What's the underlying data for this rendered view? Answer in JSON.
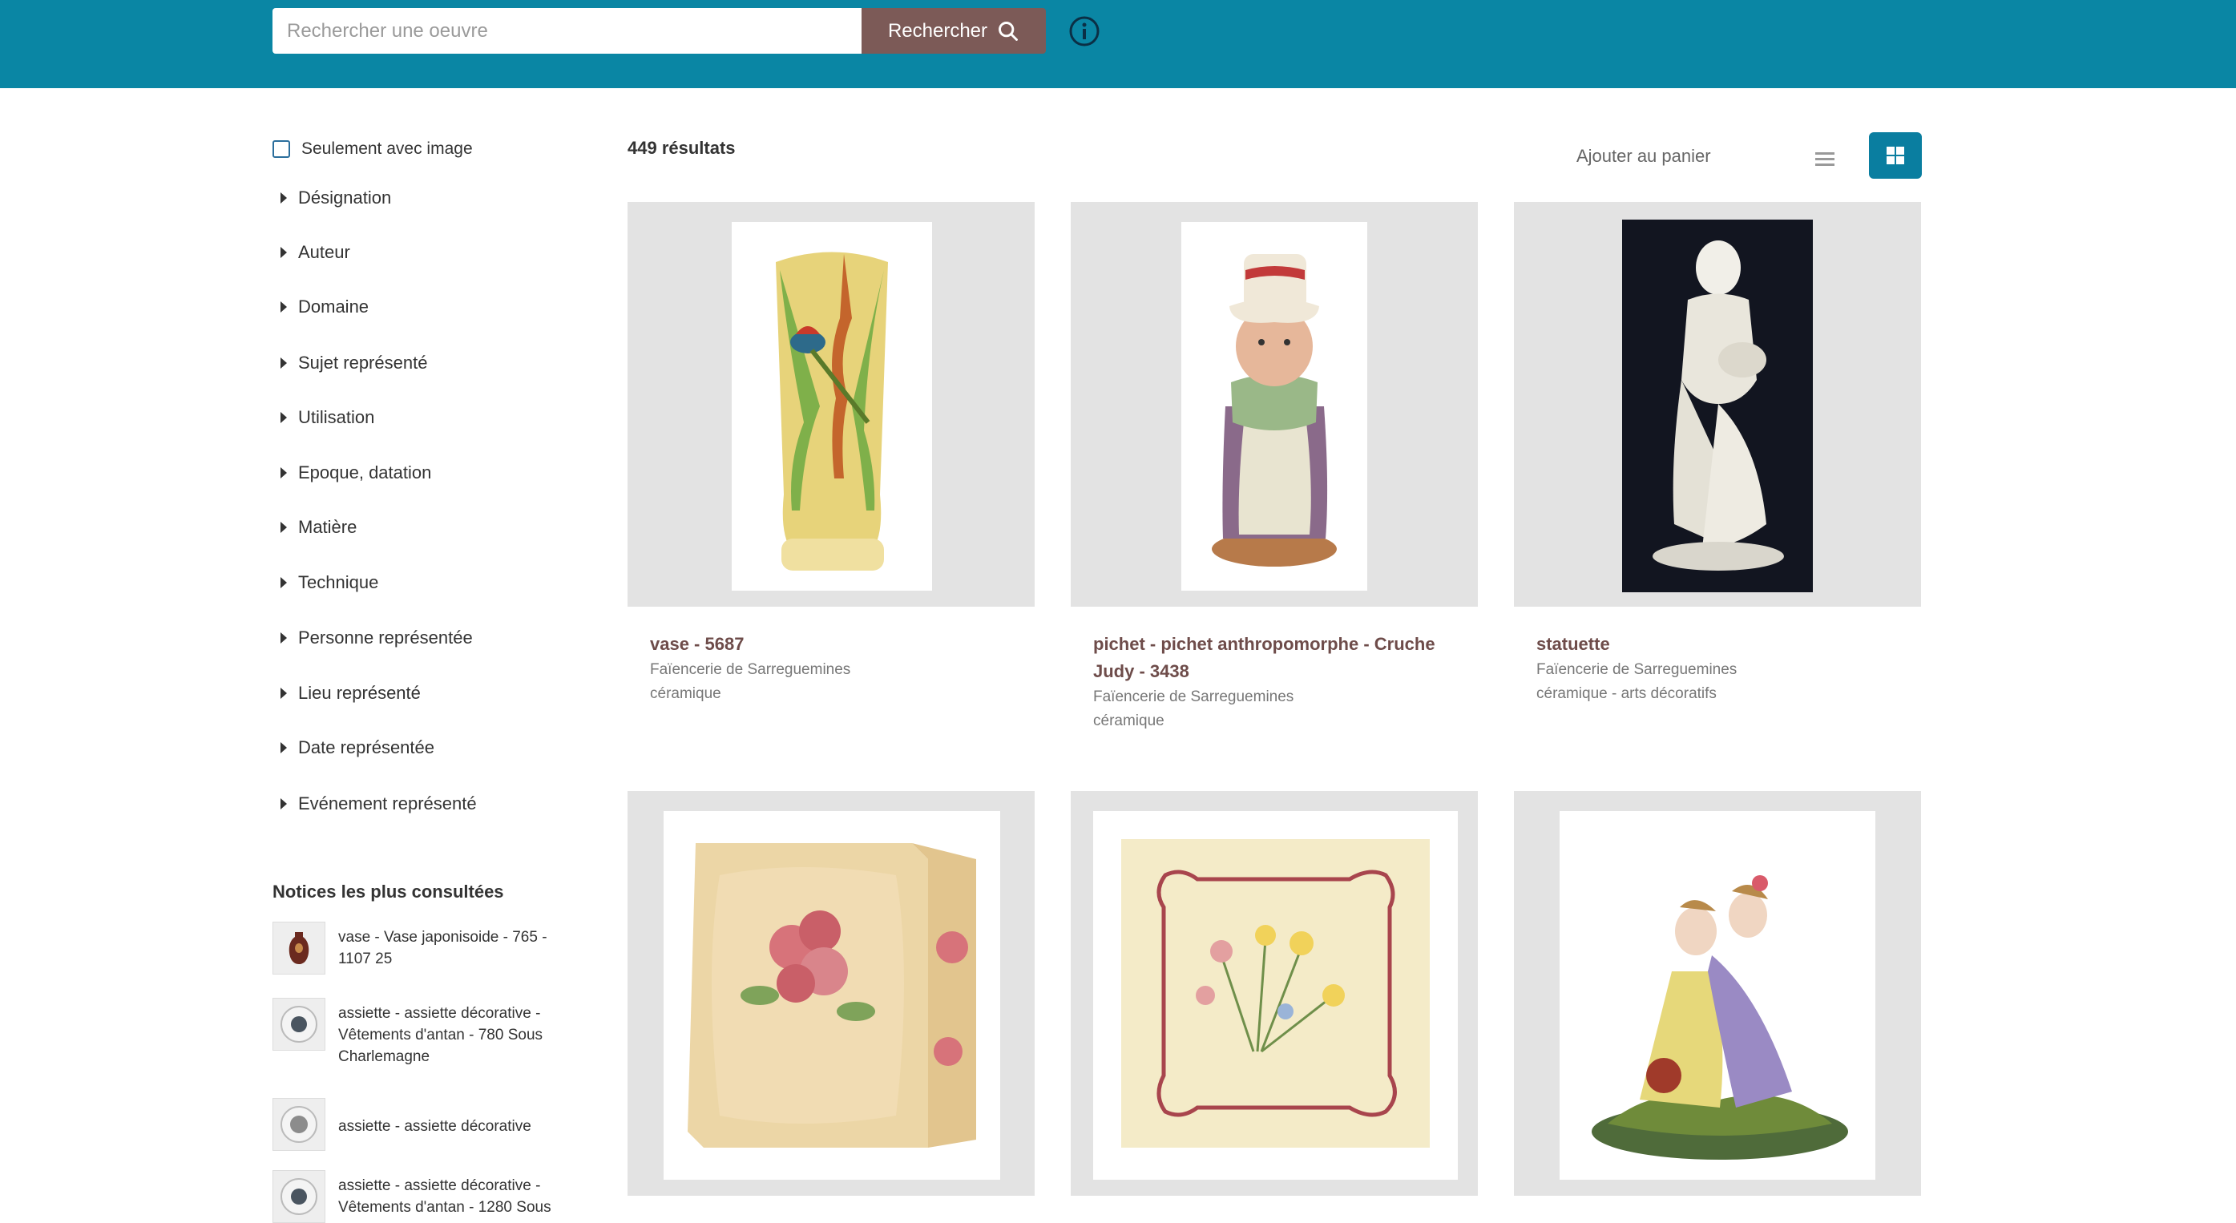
{
  "search": {
    "placeholder": "Rechercher une oeuvre",
    "button_label": "Rechercher"
  },
  "filters": {
    "only_with_image_label": "Seulement avec image",
    "facets": [
      "Désignation",
      "Auteur",
      "Domaine",
      "Sujet représenté",
      "Utilisation",
      "Epoque, datation",
      "Matière",
      "Technique",
      "Personne représentée",
      "Lieu représenté",
      "Date représentée",
      "Evénement représenté"
    ]
  },
  "popular": {
    "title": "Notices les plus consultées",
    "items": [
      "vase - Vase japonisoide - 765 - 1107 25",
      "assiette - assiette décorative - Vêtements d'antan - 780 Sous Charlemagne",
      "assiette - assiette décorative",
      "assiette - assiette décorative - Vêtements d'antan - 1280 Sous"
    ]
  },
  "results": {
    "count": "449 résultats",
    "add_to_cart": "Ajouter au panier"
  },
  "cards": [
    {
      "title": "vase - 5687",
      "maker": "Faïencerie de Sarreguemines",
      "domain": "céramique"
    },
    {
      "title": "pichet - pichet anthropomorphe - Cruche Judy - 3438",
      "maker": "Faïencerie de Sarreguemines",
      "domain": "céramique"
    },
    {
      "title": "statuette",
      "maker": "Faïencerie de Sarreguemines",
      "domain": "céramique - arts décoratifs"
    },
    {
      "title": "",
      "maker": "",
      "domain": ""
    },
    {
      "title": "",
      "maker": "",
      "domain": ""
    },
    {
      "title": "",
      "maker": "",
      "domain": ""
    }
  ],
  "colors": {
    "header": "#0a86a4",
    "search_button": "#7c5a57",
    "title_text": "#6e4c4a",
    "grid_active": "#0a7ea0"
  },
  "icons": [
    "search-icon",
    "info-icon",
    "list-view-icon",
    "grid-view-icon",
    "caret-right-icon"
  ]
}
